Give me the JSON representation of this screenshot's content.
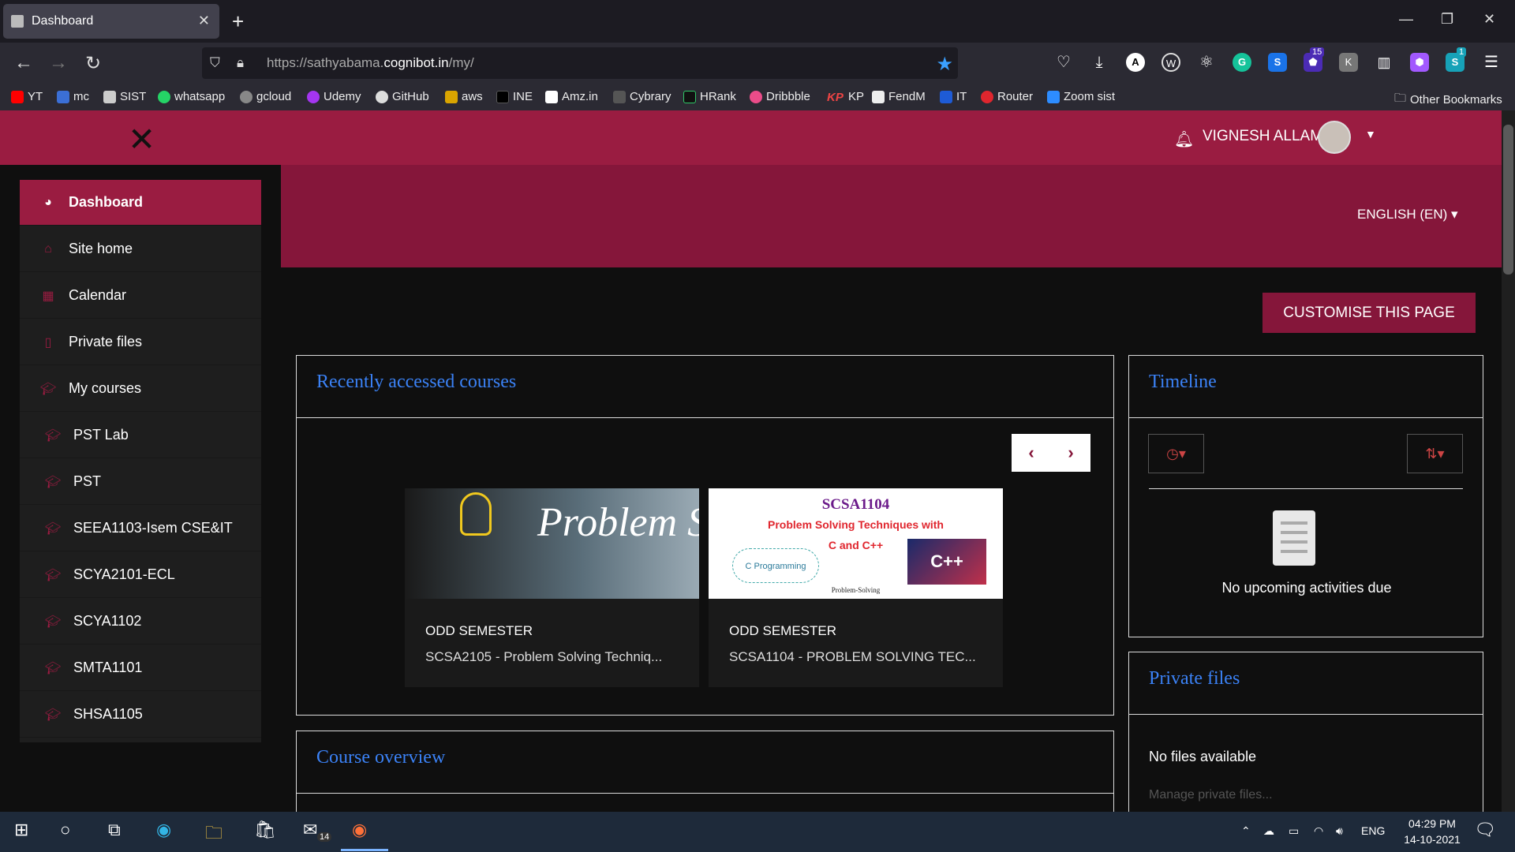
{
  "browser": {
    "tab_title": "Dashboard",
    "url_prefix": "https://sathyabama.",
    "url_domain": "cognibot.in",
    "url_suffix": "/my/",
    "bookmarks": [
      "YT",
      "mc",
      "SIST",
      "whatsapp",
      "gcloud",
      "Udemy",
      "GitHub",
      "aws",
      "INE",
      "Amz.in",
      "Cybrary",
      "HRank",
      "Dribbble",
      "KP",
      "FendM",
      "IT",
      "Router",
      "Zoom sist"
    ],
    "other_bookmarks": "Other Bookmarks",
    "extension_badges": {
      "ext1": "15",
      "ext2": "1"
    }
  },
  "header": {
    "user_name": "VIGNESH ALLAM",
    "language": "ENGLISH (EN)"
  },
  "sidebar": {
    "items": [
      {
        "label": "Dashboard",
        "active": true,
        "icon": "dashboard-icon"
      },
      {
        "label": "Site home",
        "icon": "home-icon"
      },
      {
        "label": "Calendar",
        "icon": "calendar-icon"
      },
      {
        "label": "Private files",
        "icon": "file-icon"
      },
      {
        "label": "My courses",
        "icon": "graduation-cap-icon"
      },
      {
        "label": "PST Lab",
        "icon": "graduation-cap-icon"
      },
      {
        "label": "PST",
        "icon": "graduation-cap-icon"
      },
      {
        "label": "SEEA1103-Isem CSE&IT",
        "icon": "graduation-cap-icon"
      },
      {
        "label": "SCYA2101-ECL",
        "icon": "graduation-cap-icon"
      },
      {
        "label": "SCYA1102",
        "icon": "graduation-cap-icon"
      },
      {
        "label": "SMTA1101",
        "icon": "graduation-cap-icon"
      },
      {
        "label": "SHSA1105",
        "icon": "graduation-cap-icon"
      }
    ]
  },
  "main": {
    "customise_button": "CUSTOMISE THIS PAGE",
    "recent": {
      "title": "Recently accessed courses",
      "cards": [
        {
          "image_text": "Problem Solving",
          "semester": "ODD SEMESTER",
          "name": "SCSA2105 - Problem Solving Techniq..."
        },
        {
          "image_code": "SCSA1104",
          "image_subtitle": "Problem Solving Techniques with",
          "image_subtitle2": "C and C++",
          "image_badge": "C++",
          "image_footer": "Problem-Solving",
          "image_wordcloud": "C Programming",
          "semester": "ODD SEMESTER",
          "name": "SCSA1104 - PROBLEM SOLVING TEC..."
        }
      ]
    },
    "overview_title": "Course overview"
  },
  "timeline": {
    "title": "Timeline",
    "empty_text": "No upcoming activities due"
  },
  "private_files": {
    "title": "Private files",
    "empty_text": "No files available",
    "manage_link": "Manage private files..."
  },
  "taskbar": {
    "time": "04:29 PM",
    "date": "14-10-2021",
    "lang": "ENG",
    "mail_badge": "14"
  },
  "colors": {
    "brand": "#9a1c41",
    "brand_dark": "#85163a",
    "link": "#3b82f6"
  }
}
